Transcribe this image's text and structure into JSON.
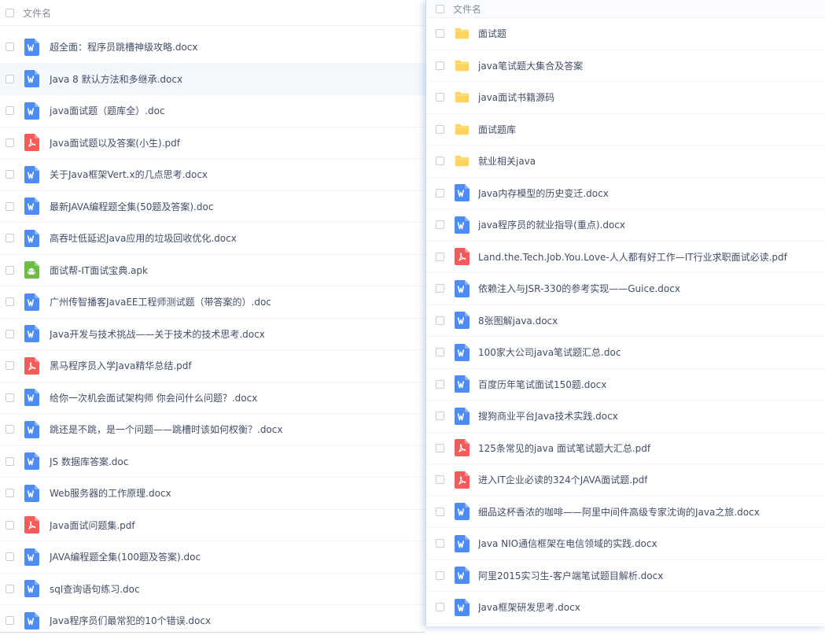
{
  "left_pane": {
    "header": {
      "label": "文件名"
    },
    "files": [
      {
        "name": "超全面：程序员跳槽神级攻略.docx",
        "type": "word"
      },
      {
        "name": "Java 8 默认方法和多继承.docx",
        "type": "word",
        "hover": true
      },
      {
        "name": "java面试题（题库全）.doc",
        "type": "word"
      },
      {
        "name": "Java面试题以及答案(小生).pdf",
        "type": "pdf"
      },
      {
        "name": "关于Java框架Vert.x的几点思考.docx",
        "type": "word"
      },
      {
        "name": "最新JAVA编程题全集(50题及答案).doc",
        "type": "word"
      },
      {
        "name": "高吞吐低延迟Java应用的垃圾回收优化.docx",
        "type": "word"
      },
      {
        "name": "面试帮-IT面试宝典.apk",
        "type": "apk"
      },
      {
        "name": "广州传智播客JavaEE工程师测试题（带答案的）.doc",
        "type": "word"
      },
      {
        "name": "Java开发与技术挑战——关于技术的技术思考.docx",
        "type": "word"
      },
      {
        "name": "黑马程序员入学Java精华总结.pdf",
        "type": "pdf"
      },
      {
        "name": "给你一次机会面试架构师 你会问什么问题？.docx",
        "type": "word"
      },
      {
        "name": "跳还是不跳，是一个问题——跳槽时该如何权衡？.docx",
        "type": "word"
      },
      {
        "name": "JS 数据库答案.doc",
        "type": "word"
      },
      {
        "name": "Web服务器的工作原理.docx",
        "type": "word"
      },
      {
        "name": "Java面试问题集.pdf",
        "type": "pdf"
      },
      {
        "name": "JAVA编程题全集(100题及答案).doc",
        "type": "word"
      },
      {
        "name": "sql查询语句练习.doc",
        "type": "word"
      },
      {
        "name": "Java程序员们最常犯的10个错误.docx",
        "type": "word"
      }
    ]
  },
  "right_pane": {
    "header": {
      "label": "文件名"
    },
    "files": [
      {
        "name": "面试题",
        "type": "folder"
      },
      {
        "name": "java笔试题大集合及答案",
        "type": "folder"
      },
      {
        "name": "java面试书籍源码",
        "type": "folder"
      },
      {
        "name": "面试题库",
        "type": "folder"
      },
      {
        "name": "就业相关java",
        "type": "folder"
      },
      {
        "name": "Java内存模型的历史变迁.docx",
        "type": "word"
      },
      {
        "name": "java程序员的就业指导(重点).docx",
        "type": "word"
      },
      {
        "name": "Land.the.Tech.Job.You.Love-人人都有好工作—IT行业求职面试必读.pdf",
        "type": "pdf"
      },
      {
        "name": "依赖注入与JSR-330的参考实现——Guice.docx",
        "type": "word"
      },
      {
        "name": "8张图解java.docx",
        "type": "word"
      },
      {
        "name": "100家大公司java笔试题汇总.doc",
        "type": "word"
      },
      {
        "name": "百度历年笔试面试150题.docx",
        "type": "word"
      },
      {
        "name": "搜狗商业平台Java技术实践.docx",
        "type": "word"
      },
      {
        "name": "125条常见的java 面试笔试题大汇总.pdf",
        "type": "pdf"
      },
      {
        "name": "进入IT企业必读的324个JAVA面试题.pdf",
        "type": "pdf"
      },
      {
        "name": "细品这杯香浓的咖啡——阿里中间件高级专家沈询的Java之旅.docx",
        "type": "word"
      },
      {
        "name": "Java NIO通信框架在电信领域的实践.docx",
        "type": "word"
      },
      {
        "name": "阿里2015实习生-客户端笔试题目解析.docx",
        "type": "word"
      },
      {
        "name": "Java框架研发思考.docx",
        "type": "word"
      }
    ]
  },
  "icons": {
    "word": "word-doc-icon",
    "pdf": "pdf-file-icon",
    "apk": "android-apk-icon",
    "folder": "folder-icon"
  },
  "colors": {
    "word": "#4d8cf5",
    "pdf": "#f45b5b",
    "apk": "#6cbd45",
    "folder": "#ffd45c",
    "text": "#424e67",
    "header_text": "#878c9c"
  }
}
